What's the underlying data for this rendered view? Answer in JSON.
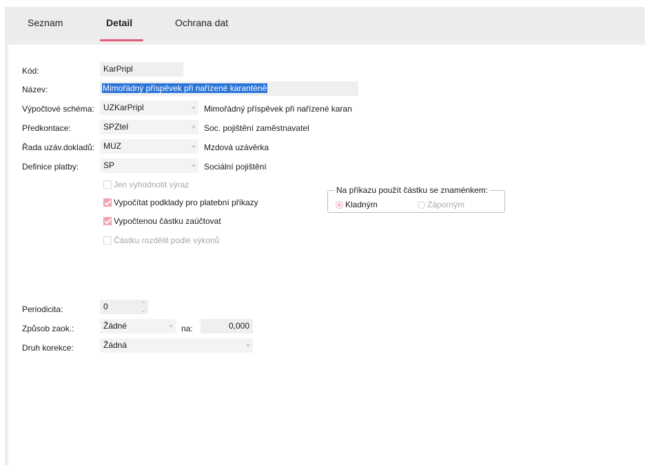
{
  "tabs": [
    {
      "label": "Seznam",
      "active": false
    },
    {
      "label": "Detail",
      "active": true
    },
    {
      "label": "Ochrana dat",
      "active": false
    }
  ],
  "form": {
    "kod": {
      "label": "Kód:",
      "value": "KarPripl"
    },
    "nazev": {
      "label": "Název:",
      "value": "Mimořádný příspěvek při nařízené karanténě"
    },
    "vypoctove_schema": {
      "label": "Výpočtové schéma:",
      "value": "UZKarPripl",
      "description": "Mimořádný příspěvek při nařízené karan"
    },
    "predkontace": {
      "label": "Předkontace:",
      "value": "SPZtel",
      "description": "Soc. pojištění zaměstnavatel"
    },
    "rada_uzav_dokladu": {
      "label": "Řada uzáv.dokladů:",
      "value": "MUZ",
      "description": "Mzdová uzávěrka"
    },
    "definice_platby": {
      "label": "Definice platby:",
      "value": "SP",
      "description": "Sociální pojištění"
    }
  },
  "checkboxes": [
    {
      "label": "Jen vyhodnotit výraz",
      "checked": false,
      "disabled": true
    },
    {
      "label": "Vypočítat podklady pro platební příkazy",
      "checked": true,
      "disabled": false
    },
    {
      "label": "Vypočtenou částku zaúčtovat",
      "checked": true,
      "disabled": false
    },
    {
      "label": "Částku rozdělit podle výkonů",
      "checked": false,
      "disabled": true
    }
  ],
  "sign_group": {
    "title": "Na příkazu použít částku se znaménkem:",
    "options": [
      {
        "label": "Kladným",
        "selected": true
      },
      {
        "label": "Záporným",
        "selected": false
      }
    ]
  },
  "bottom": {
    "periodicita": {
      "label": "Periodicita:",
      "value": "0"
    },
    "zpusob_zaok": {
      "label": "Způsob zaok.:",
      "value": "Žádné",
      "na_label": "na:",
      "na_value": "0,000"
    },
    "druh_korekce": {
      "label": "Druh korekce:",
      "value": "Žádná"
    }
  },
  "colors": {
    "accent": "#e05a7a",
    "selection": "#2a74d8",
    "checkbox_checked": "#f0a5b5"
  }
}
